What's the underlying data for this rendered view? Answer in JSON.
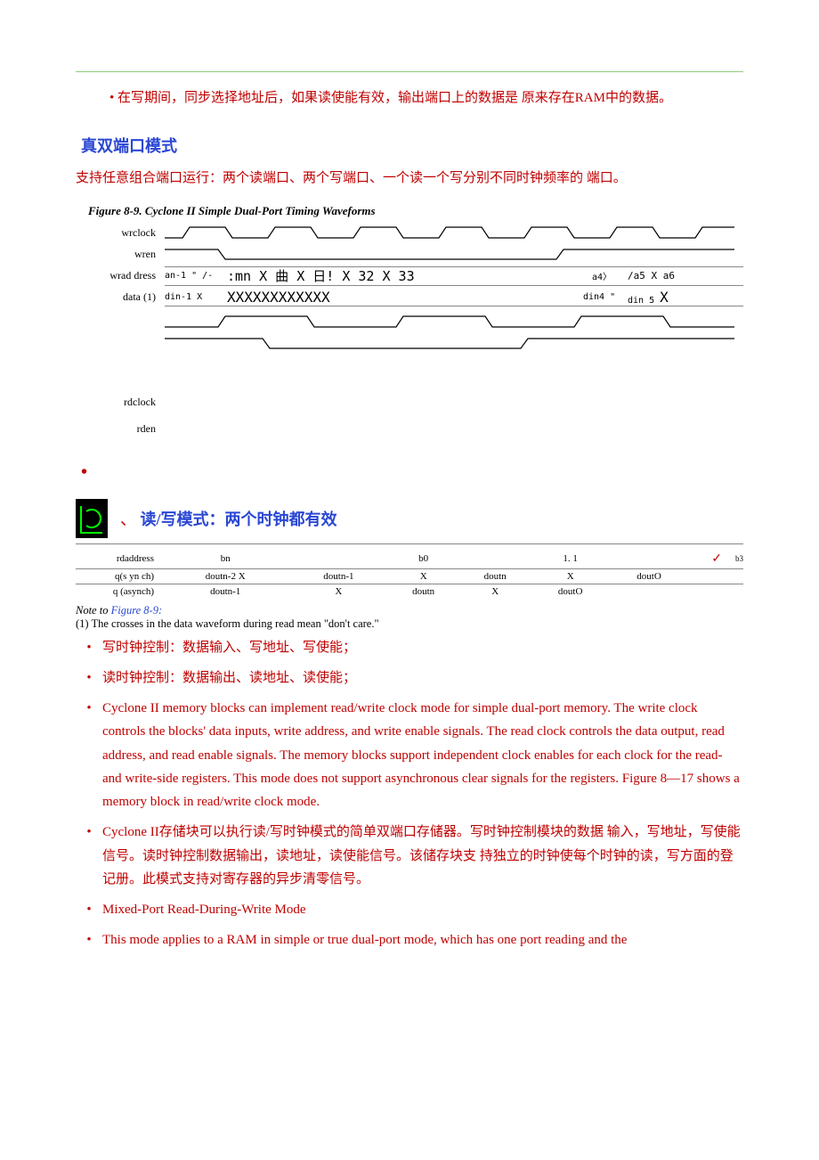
{
  "top_bullet": "在写期间，同步选择地址后，如果读使能有效，输出端口上的数据是  原来存在RAM中的数据。",
  "heading1": "真双端口模式",
  "heading1_desc": "支持任意组合端口运行：两个读端口、两个写端口、一个读一个写分别不同时钟频率的 端口。",
  "figure_caption": "Figure 8-9. Cyclone II Simple Dual-Port Timing Waveforms",
  "wf_labels": {
    "wrclock": "wrclock",
    "wren": "wren",
    "wraddress": "wrad dress",
    "data": "data (1)",
    "rdclock": "rdclock",
    "rden": "rden"
  },
  "wf_text": {
    "addr_left": "an-1 \" /-",
    "addr_mid": ":mn X 曲 X 日! X 32 X 33",
    "addr_right1": "a4〉",
    "addr_right2": "/a5 X  a6",
    "data_left": "din-1 X",
    "data_mid": "XXXXXXXXXXXX",
    "data_right1": "din4 \"",
    "data_right2": "din 5"
  },
  "heading2_prefix": "、",
  "heading2": "读/写模式：两个时钟都有效",
  "rw_labels": {
    "rdaddress": "rdaddress",
    "qsynch": "q(s yn ch)",
    "qasynch": "q (asynch)"
  },
  "rw_row1": [
    "bn",
    "",
    "b0",
    "",
    "1.  1",
    "",
    "",
    ""
  ],
  "rw_row1_tick": "✓",
  "rw_row1_end": "b3",
  "rw_row2": [
    "doutn-2 X",
    "doutn-1",
    "X",
    "doutn",
    "X",
    "",
    "doutO",
    ""
  ],
  "rw_row3": [
    "doutn-1",
    "X",
    "doutn",
    "X",
    "doutO",
    "",
    "",
    ""
  ],
  "note_prefix": "Note to ",
  "note_link": "Figure 8-9:",
  "note_body": "(1) The crosses in the data waveform during read mean \"don't care.\"",
  "bullets": [
    "写时钟控制：数据输入、写地址、写使能；",
    "读时钟控制：数据输出、读地址、读使能；",
    "Cyclone II memory blocks can implement read/write clock mode for simple dual-port memory. The write clock controls the blocks' data inputs, write address, and write enable signals. The read clock controls the data output, read address, and read enable signals. The memory blocks support independent clock enables for each clock for the read- and write-side registers. This mode does not support asynchronous clear signals for the registers. Figure 8—17 shows a memory block in read/write clock mode.",
    "Cyclone II存储块可以执行读/写时钟模式的简单双端口存储器。写时钟控制模块的数据 输入，写地址，写使能信号。读时钟控制数据输出，读地址，读使能信号。该储存块支 持独立的时钟使每个时钟的读，写方面的登记册。此模式支持对寄存器的异步清零信号。",
    "Mixed-Port Read-During-Write Mode",
    "This mode applies to a RAM in simple or true dual-port mode, which has one port reading and the"
  ]
}
